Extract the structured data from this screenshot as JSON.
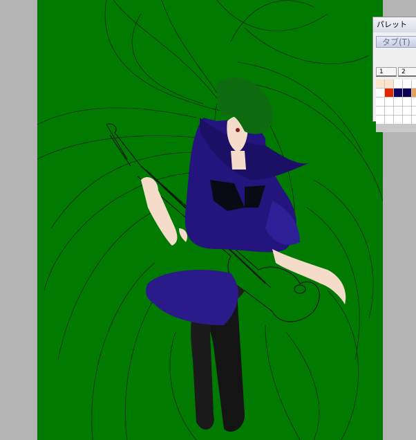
{
  "palette": {
    "title": "パレット",
    "tab_label": "タブ(T)",
    "pages": [
      "1",
      "2"
    ],
    "swatches": [
      "#fbe4cc",
      "#fbe4cc",
      "#ffffff",
      "#ffffff",
      "#ffffff",
      "#ffffff",
      "#ffffff",
      "#e02800",
      "#0c0060",
      "#0c0050",
      "#e6a060",
      "#ffffff",
      "#ffffff",
      "#ffffff",
      "#ffffff",
      "#ffffff",
      "#ffffff",
      "#ffffff",
      "#ffffff",
      "#ffffff",
      "#ffffff",
      "#ffffff",
      "#ffffff",
      "#ffffff",
      "#ffffff",
      "#ffffff",
      "#ffffff",
      "#ffffff",
      "#ffffff",
      "#ffffff"
    ]
  },
  "canvas": {
    "background": "#007a00",
    "outside_color": "#b4b4b4"
  }
}
